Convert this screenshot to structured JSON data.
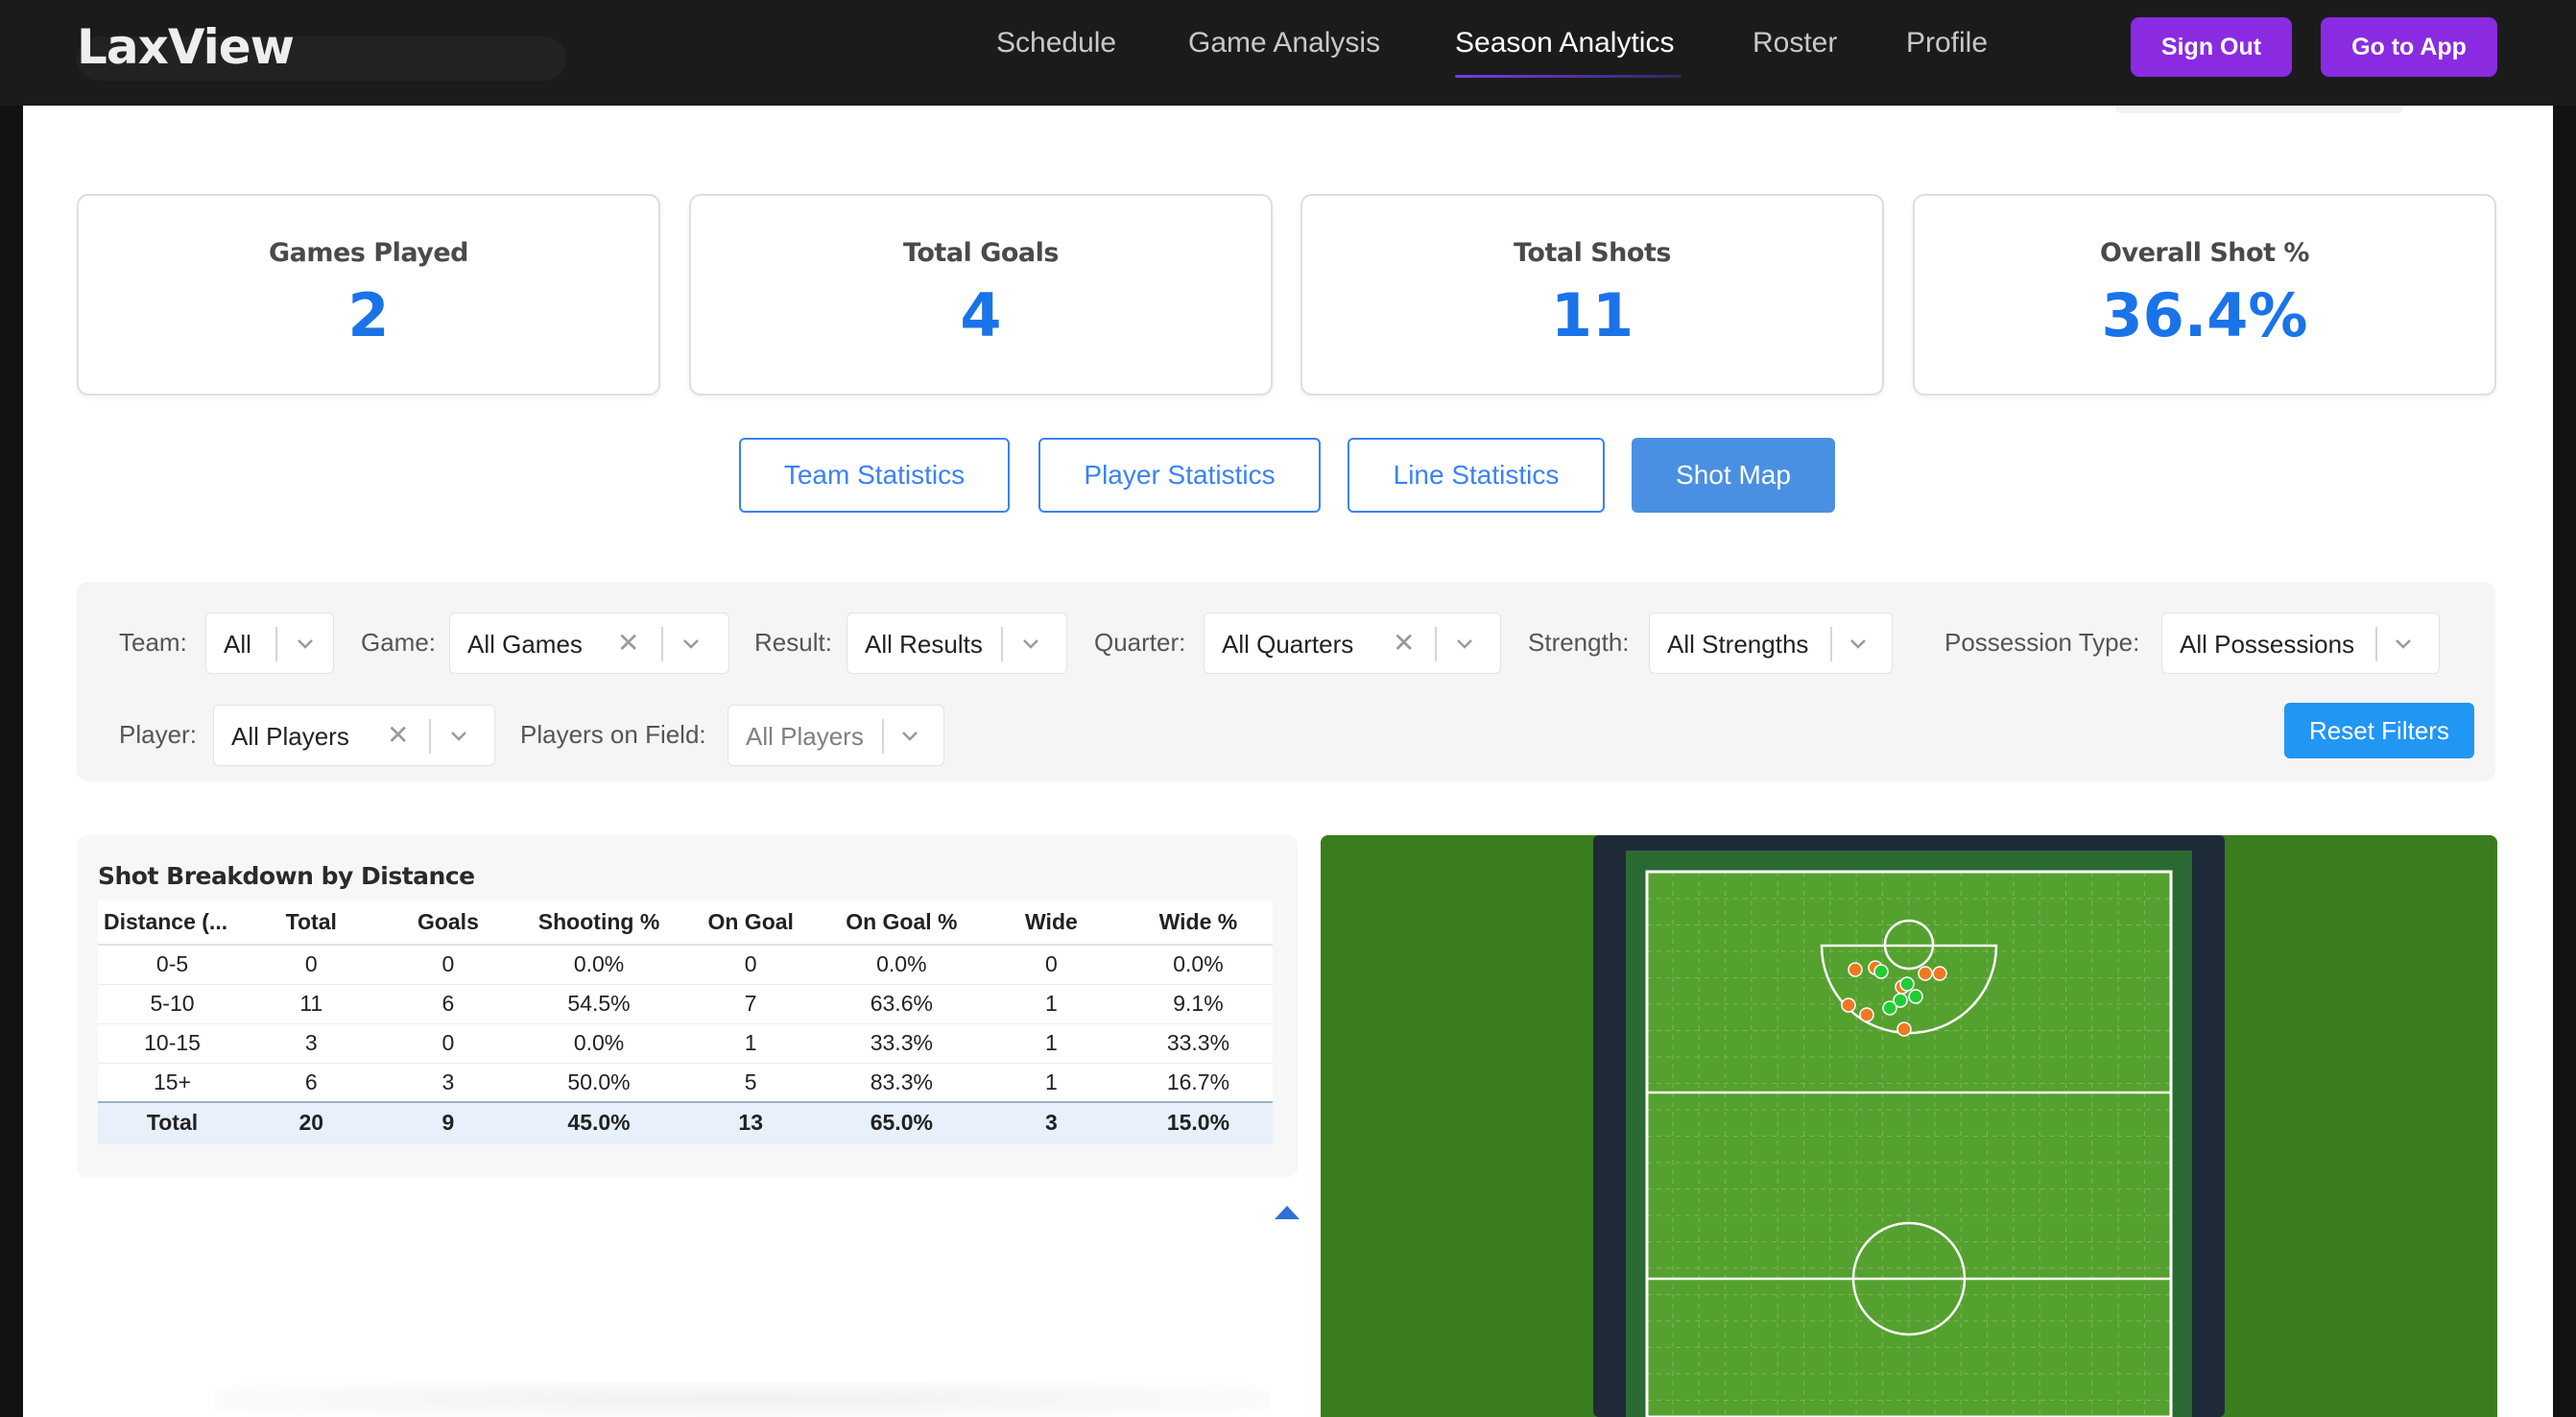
{
  "app": {
    "logo": "LaxView"
  },
  "nav": {
    "links": [
      "Schedule",
      "Game Analysis",
      "Season Analytics",
      "Roster",
      "Profile"
    ],
    "active": "Season Analytics",
    "sign_out": "Sign Out",
    "go_to_app": "Go to App"
  },
  "stats": [
    {
      "label": "Games Played",
      "value": "2"
    },
    {
      "label": "Total Goals",
      "value": "4"
    },
    {
      "label": "Total Shots",
      "value": "11"
    },
    {
      "label": "Overall Shot %",
      "value": "36.4%"
    }
  ],
  "tabs": [
    {
      "label": "Team Statistics",
      "active": false
    },
    {
      "label": "Player Statistics",
      "active": false
    },
    {
      "label": "Line Statistics",
      "active": false
    },
    {
      "label": "Shot Map",
      "active": true
    }
  ],
  "filters": {
    "team": {
      "label": "Team:",
      "value": "All"
    },
    "game": {
      "label": "Game:",
      "value": "All Games"
    },
    "result": {
      "label": "Result:",
      "value": "All Results"
    },
    "quarter": {
      "label": "Quarter:",
      "value": "All Quarters"
    },
    "strength": {
      "label": "Strength:",
      "value": "All Strengths"
    },
    "possession": {
      "label": "Possession Type:",
      "value": "All Possessions"
    },
    "player": {
      "label": "Player:",
      "value": "All Players"
    },
    "players_on_field": {
      "label": "Players on Field:",
      "placeholder": "All Players"
    },
    "reset": "Reset Filters"
  },
  "breakdown": {
    "title": "Shot Breakdown by Distance",
    "columns": [
      "Distance (...",
      "Total",
      "Goals",
      "Shooting %",
      "On Goal",
      "On Goal %",
      "Wide",
      "Wide %"
    ],
    "rows": [
      [
        "0-5",
        "0",
        "0",
        "0.0%",
        "0",
        "0.0%",
        "0",
        "0.0%"
      ],
      [
        "5-10",
        "11",
        "6",
        "54.5%",
        "7",
        "63.6%",
        "1",
        "9.1%"
      ],
      [
        "10-15",
        "3",
        "0",
        "0.0%",
        "1",
        "33.3%",
        "1",
        "33.3%"
      ],
      [
        "15+",
        "6",
        "3",
        "50.0%",
        "5",
        "83.3%",
        "1",
        "16.7%"
      ]
    ],
    "total": [
      "Total",
      "20",
      "9",
      "45.0%",
      "13",
      "65.0%",
      "3",
      "15.0%"
    ]
  },
  "shot_map": {
    "colors": {
      "field": "#3a7d1e",
      "turf": "#55a12f",
      "border": "#1e2a38",
      "goal": "#22cc33",
      "miss": "#f07820"
    },
    "shots": [
      {
        "result": "miss"
      },
      {
        "result": "miss"
      },
      {
        "result": "goal"
      },
      {
        "result": "miss"
      },
      {
        "result": "miss"
      },
      {
        "result": "miss"
      },
      {
        "result": "goal"
      },
      {
        "result": "goal"
      },
      {
        "result": "goal"
      },
      {
        "result": "miss"
      },
      {
        "result": "miss"
      },
      {
        "result": "goal"
      },
      {
        "result": "miss"
      }
    ]
  }
}
